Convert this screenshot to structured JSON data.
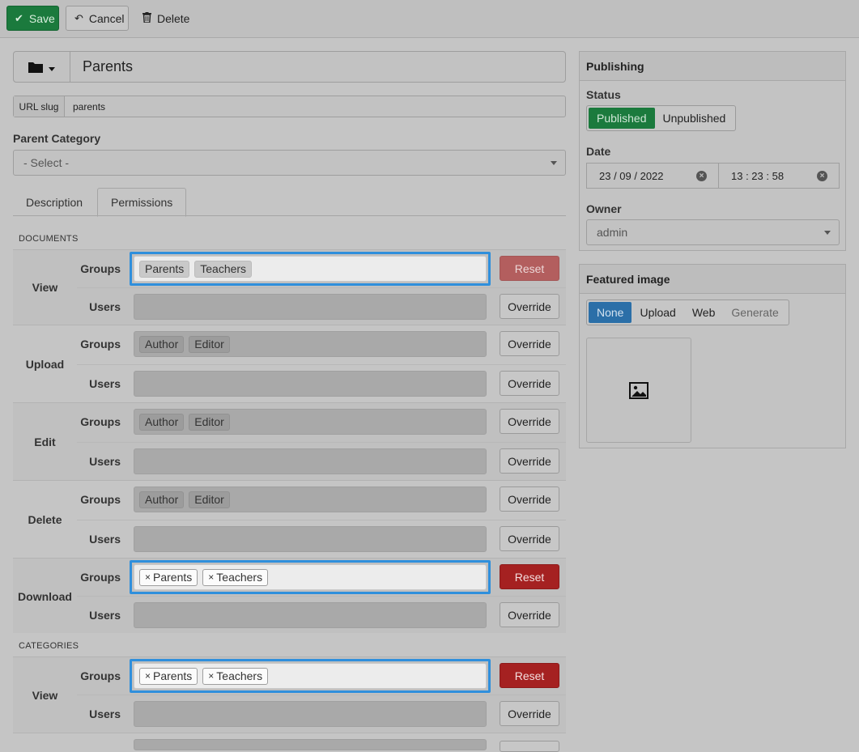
{
  "toolbar": {
    "save": "Save",
    "cancel": "Cancel",
    "delete": "Delete"
  },
  "title": "Parents",
  "slug": {
    "label": "URL slug",
    "value": "parents"
  },
  "parent_category": {
    "label": "Parent Category",
    "value": "- Select -"
  },
  "tabs": [
    "Description",
    "Permissions"
  ],
  "sections": {
    "documents": "DOCUMENTS",
    "categories": "CATEGORIES"
  },
  "row_labels": {
    "groups": "Groups",
    "users": "Users"
  },
  "buttons": {
    "reset": "Reset",
    "override": "Override"
  },
  "tags": {
    "parents": "Parents",
    "teachers": "Teachers",
    "author": "Author",
    "editor": "Editor",
    "x": "×"
  },
  "permissions": {
    "documents": [
      "View",
      "Upload",
      "Edit",
      "Delete",
      "Download"
    ],
    "categories": [
      "View"
    ]
  },
  "publishing": {
    "header": "Publishing",
    "status_label": "Status",
    "status_options": [
      "Published",
      "Unpublished"
    ],
    "status_selected": "Published",
    "date_label": "Date",
    "date": "23 / 09 / 2022",
    "time": "13 : 23 : 58",
    "owner_label": "Owner",
    "owner": "admin"
  },
  "featured_image": {
    "header": "Featured image",
    "options": [
      "None",
      "Upload",
      "Web",
      "Generate"
    ],
    "selected": "None"
  },
  "colors": {
    "accent_blue": "#2f8fdc",
    "save_green": "#1b7a3d",
    "reset_red": "#a52121"
  },
  "icons": [
    "check-icon",
    "undo-icon",
    "trash-icon",
    "folder-icon",
    "chevron-down-icon",
    "image-icon",
    "clear-icon"
  ]
}
